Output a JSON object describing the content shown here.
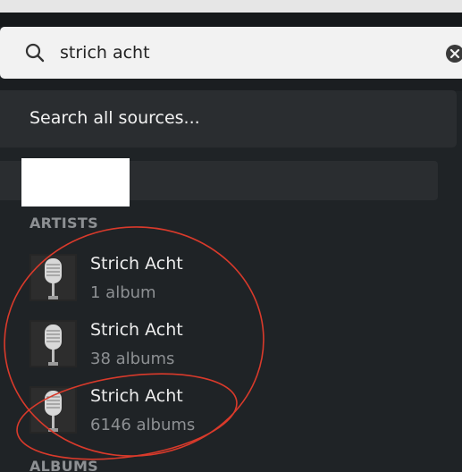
{
  "search": {
    "value": "strich acht",
    "search_all_label": "Search all sources..."
  },
  "icons": {
    "search": "search-icon",
    "clear": "clear-icon",
    "artist_thumb": "microphone-icon"
  },
  "sections": {
    "artists_header": "ARTISTS",
    "albums_header": "ALBUMS"
  },
  "artists": [
    {
      "name": "Strich Acht",
      "count": "1 album"
    },
    {
      "name": "Strich Acht",
      "count": "38 albums"
    },
    {
      "name": "Strich Acht",
      "count": "6146 albums"
    }
  ],
  "colors": {
    "background": "#1f2326",
    "annotation": "#d93a2b"
  }
}
